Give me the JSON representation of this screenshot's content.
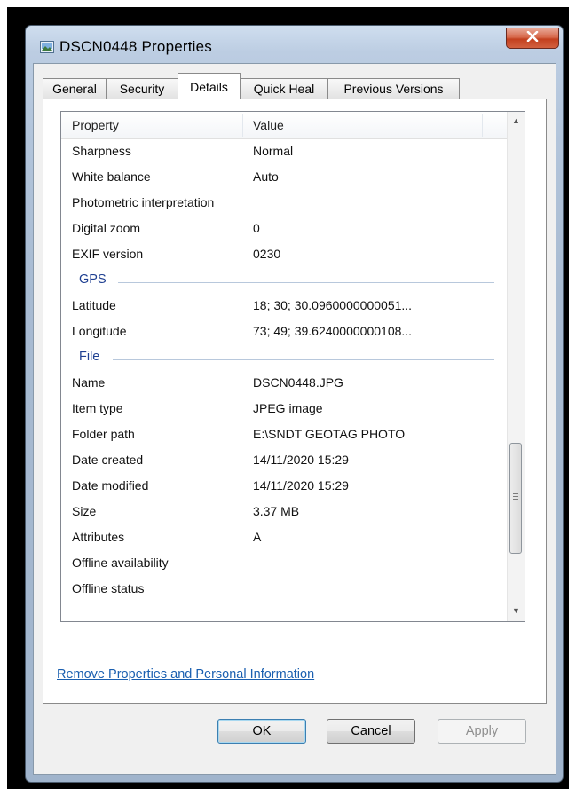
{
  "window": {
    "title": "DSCN0448 Properties"
  },
  "tabs": [
    {
      "label": "General"
    },
    {
      "label": "Security"
    },
    {
      "label": "Details"
    },
    {
      "label": "Quick Heal"
    },
    {
      "label": "Previous Versions"
    }
  ],
  "details": {
    "column_property": "Property",
    "column_value": "Value",
    "rows_a": [
      {
        "property": "Sharpness",
        "value": "Normal"
      },
      {
        "property": "White balance",
        "value": "Auto"
      },
      {
        "property": "Photometric interpretation",
        "value": ""
      },
      {
        "property": "Digital zoom",
        "value": "0"
      },
      {
        "property": "EXIF version",
        "value": "0230"
      }
    ],
    "group_gps": "GPS",
    "rows_gps": [
      {
        "property": "Latitude",
        "value": "18; 30; 30.0960000000051..."
      },
      {
        "property": "Longitude",
        "value": "73; 49; 39.6240000000108..."
      }
    ],
    "group_file": "File",
    "rows_file": [
      {
        "property": "Name",
        "value": "DSCN0448.JPG"
      },
      {
        "property": "Item type",
        "value": "JPEG image"
      },
      {
        "property": "Folder path",
        "value": "E:\\SNDT GEOTAG PHOTO"
      },
      {
        "property": "Date created",
        "value": "14/11/2020 15:29"
      },
      {
        "property": "Date modified",
        "value": "14/11/2020 15:29"
      },
      {
        "property": "Size",
        "value": "3.37 MB"
      },
      {
        "property": "Attributes",
        "value": "A"
      },
      {
        "property": "Offline availability",
        "value": ""
      },
      {
        "property": "Offline status",
        "value": ""
      }
    ]
  },
  "link": {
    "remove_properties": "Remove Properties and Personal Information"
  },
  "buttons": {
    "ok": "OK",
    "cancel": "Cancel",
    "apply": "Apply"
  },
  "colors": {
    "link": "#1a5fb0",
    "group_label": "#1e3f91",
    "close_button": "#c3401f"
  }
}
